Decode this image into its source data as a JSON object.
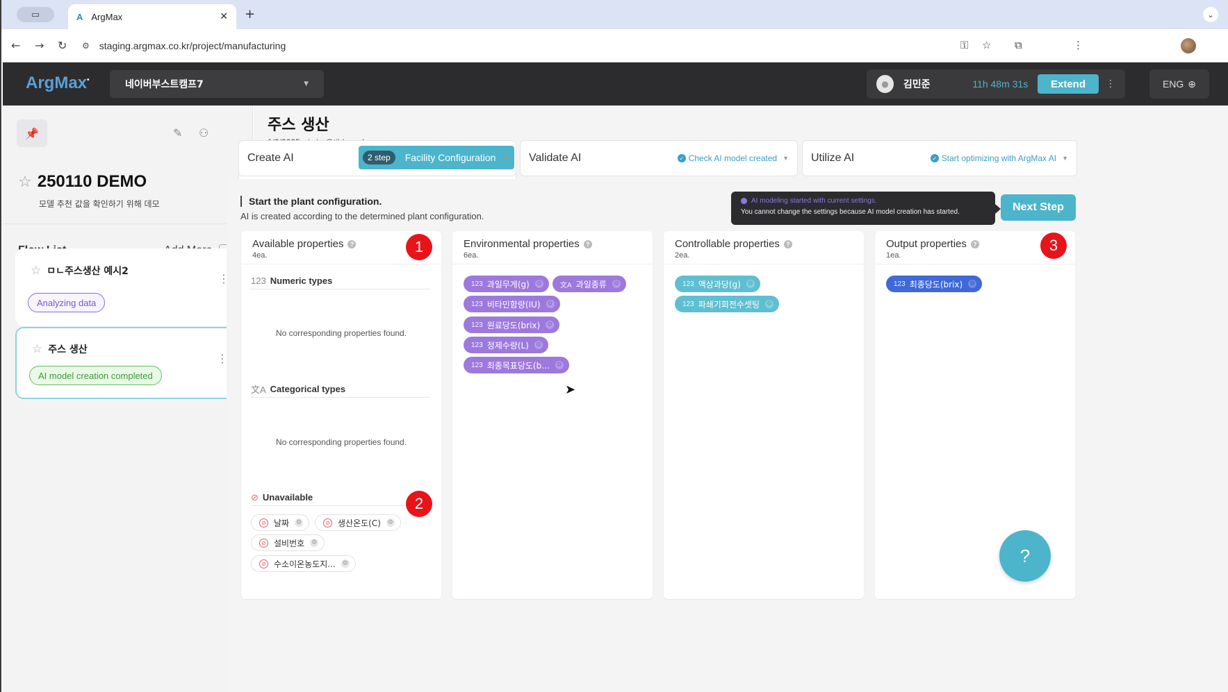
{
  "browser": {
    "tab_title": "ArgMax",
    "tab_favicon": "A",
    "url": "staging.argmax.co.kr/project/manufacturing"
  },
  "header": {
    "brand": "ArgMax",
    "project_select": "네이버부스트캠프7",
    "user_name": "김민준",
    "timer": "11h 48m 31s",
    "extend_label": "Extend",
    "lang": "ENG"
  },
  "sidebar": {
    "demo_title": "250110 DEMO",
    "demo_desc": "모델 추천 값을 확인하기 위해 데모",
    "flow_list_label": "Flow List",
    "add_more_label": "Add More",
    "flows": [
      {
        "name": "ㅁㄴ주스생산 예시2",
        "status": "Analyzing data"
      },
      {
        "name": "주스 생산",
        "status": "AI model creation completed"
      }
    ]
  },
  "page": {
    "title": "주스 생산",
    "date": "1/9/2025",
    "email": "js.im@tilda.co.kr"
  },
  "steps": {
    "create_label": "Create AI",
    "create_step_pill": "2 step",
    "create_step_text": "Facility Configuration",
    "validate_label": "Validate AI",
    "validate_status": "Check AI model created",
    "utilize_label": "Utilize AI",
    "utilize_status": "Start optimizing with ArgMax AI"
  },
  "config": {
    "heading": "Start the plant configuration.",
    "sub": "AI is created according to the determined plant configuration.",
    "tooltip_line1": "AI modeling started with current settings.",
    "tooltip_line2": "You cannot change the settings because AI model creation has started.",
    "next_step": "Next Step"
  },
  "panels": {
    "available": {
      "title": "Available properties",
      "count": "4ea.",
      "marker": "1",
      "numeric_label": "Numeric types",
      "numeric_icon": "123",
      "numeric_empty": "No corresponding properties found.",
      "categorical_label": "Categorical types",
      "categorical_empty": "No corresponding properties found.",
      "unavailable_label": "Unavailable",
      "unavailable_marker": "2",
      "unavailable_items": [
        "날짜",
        "생산온도(C)",
        "설비번호",
        "수소이온농도지..."
      ]
    },
    "environmental": {
      "title": "Environmental properties",
      "count": "6ea.",
      "chips": [
        {
          "type": "123",
          "label": "과일무게(g)"
        },
        {
          "type": "文A",
          "label": "과일종류"
        },
        {
          "type": "123",
          "label": "비타민함량(IU)"
        },
        {
          "type": "123",
          "label": "원료당도(brix)"
        },
        {
          "type": "123",
          "label": "정제수량(L)"
        },
        {
          "type": "123",
          "label": "최종목표당도(b..."
        }
      ]
    },
    "controllable": {
      "title": "Controllable properties",
      "count": "2ea.",
      "chips": [
        {
          "type": "123",
          "label": "액상과당(g)"
        },
        {
          "type": "123",
          "label": "파쇄기회전수셋팅"
        }
      ]
    },
    "output": {
      "title": "Output properties",
      "count": "1ea.",
      "marker": "3",
      "chips": [
        {
          "type": "123",
          "label": "최종당도(brix)"
        }
      ]
    }
  },
  "help_label": "?",
  "colors": {
    "accent": "#4cb4cb",
    "env_chip": "#9d79dd",
    "ctrl_chip": "#5fbfd0",
    "output_chip": "#3f68d8",
    "marker": "#e8141a"
  }
}
